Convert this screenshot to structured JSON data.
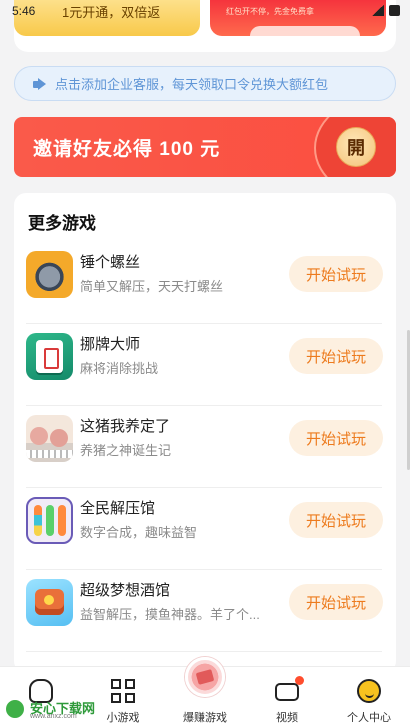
{
  "status_bar": {
    "time": "5:46"
  },
  "promos": {
    "left_text": "1元开通，双倍返",
    "right_text": "红包开不停，先金免费拿"
  },
  "notice": {
    "text": "点击添加企业客服，每天领取口令兑换大额红包",
    "color": "#5f95d6"
  },
  "invite": {
    "title": "邀请好友必得 100 元",
    "button_label": "開",
    "color": "#fa5a4a"
  },
  "games": {
    "section_title": "更多游戏",
    "action_color": "#ed7b1e",
    "items": [
      {
        "name": "锤个螺丝",
        "desc": "简单又解压，天天打螺丝",
        "action": "开始试玩",
        "icon": "screw-game-icon"
      },
      {
        "name": "挪牌大师",
        "desc": "麻将消除挑战",
        "action": "开始试玩",
        "icon": "mahjong-icon"
      },
      {
        "name": "这猪我养定了",
        "desc": "养猪之神诞生记",
        "action": "开始试玩",
        "icon": "pig-icon"
      },
      {
        "name": "全民解压馆",
        "desc": "数字合成，趣味益智",
        "action": "开始试玩",
        "icon": "sort-tubes-icon"
      },
      {
        "name": "超级梦想酒馆",
        "desc": "益智解压，摸鱼神器。羊了个...",
        "action": "开始试玩",
        "icon": "hotel-icon"
      }
    ]
  },
  "bottom_nav": {
    "items": [
      {
        "label": "",
        "icon": "home-icon"
      },
      {
        "label": "小游戏",
        "icon": "grid-icon"
      },
      {
        "label": "爆赚游戏",
        "icon": "money-icon"
      },
      {
        "label": "视频",
        "icon": "video-icon"
      },
      {
        "label": "个人中心",
        "icon": "smile-icon"
      }
    ]
  },
  "watermark": {
    "title": "安心下载网",
    "url": "www.anxz.com"
  }
}
